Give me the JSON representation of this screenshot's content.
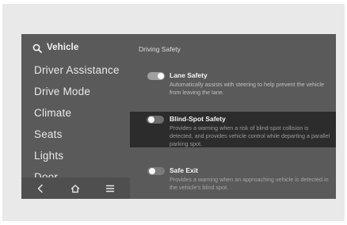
{
  "sidebar": {
    "title": "Vehicle",
    "items": [
      {
        "label": "Driver Assistance"
      },
      {
        "label": "Drive Mode"
      },
      {
        "label": "Climate"
      },
      {
        "label": "Seats"
      },
      {
        "label": "Lights"
      },
      {
        "label": "Door"
      }
    ],
    "nav": {
      "back_icon": "back-icon",
      "home_icon": "home-icon",
      "menu_icon": "menu-icon"
    }
  },
  "main": {
    "title": "Driving Safety",
    "settings": [
      {
        "title": "Lane Safety",
        "description": "Automatically assists with steering to help prevent the vehicle from leaving the lane.",
        "enabled": true
      },
      {
        "title": "Blind-Spot Safety",
        "description": "Provides a warning when a risk of blind-spot collision is detected, and provides vehicle control while departing a parallel parking spot.",
        "enabled": false
      },
      {
        "title": "Safe Exit",
        "description": "Provides a warning when an approaching vehicle is detected in the vehicle's blind spot.",
        "enabled": false
      }
    ]
  },
  "colors": {
    "screen_bg": "#5a5a5a",
    "highlight_bg": "#2c2c2c",
    "toggle_on": "#a0a0a0",
    "toggle_off": "#7a7a7a"
  }
}
